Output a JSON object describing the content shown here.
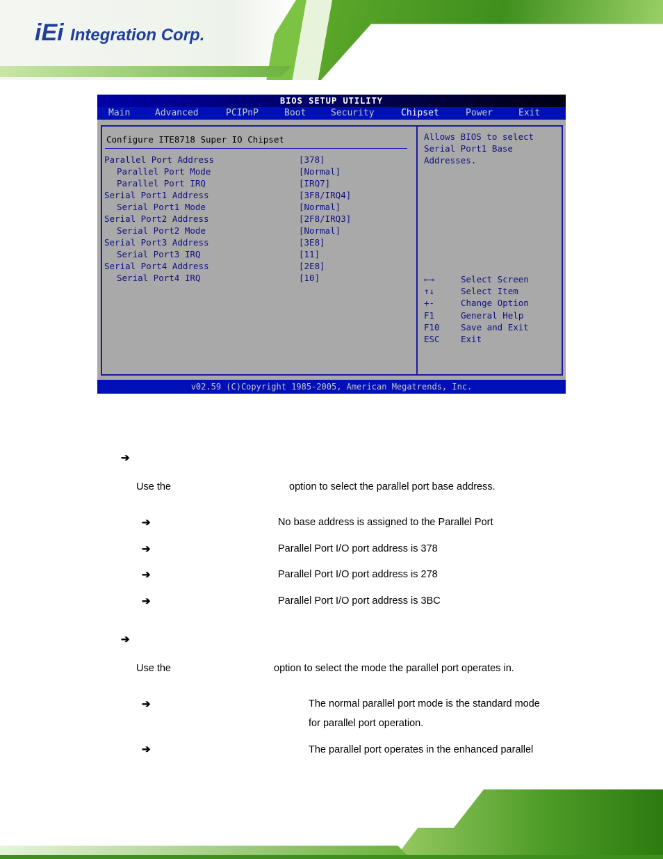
{
  "logo": {
    "text": "iEi",
    "sub": "Integration Corp."
  },
  "bios": {
    "title": "BIOS SETUP UTILITY",
    "menu": [
      "Main",
      "Advanced",
      "PCIPnP",
      "Boot",
      "Security",
      "Chipset",
      "Power",
      "Exit"
    ],
    "section_title": "Configure ITE8718 Super IO Chipset",
    "items": [
      {
        "label": "Parallel Port Address",
        "value": "[378]",
        "indent": false
      },
      {
        "label": "Parallel Port Mode",
        "value": "[Normal]",
        "indent": true
      },
      {
        "label": "Parallel Port IRQ",
        "value": "[IRQ7]",
        "indent": true
      },
      {
        "label": "Serial Port1 Address",
        "value": "[3F8/IRQ4]",
        "indent": false
      },
      {
        "label": "Serial Port1 Mode",
        "value": "[Normal]",
        "indent": true
      },
      {
        "label": "Serial Port2 Address",
        "value": "[2F8/IRQ3]",
        "indent": false
      },
      {
        "label": "Serial Port2 Mode",
        "value": "[Normal]",
        "indent": true
      },
      {
        "label": "Serial Port3 Address",
        "value": "[3E8]",
        "indent": false
      },
      {
        "label": "Serial Port3 IRQ",
        "value": "[11]",
        "indent": true
      },
      {
        "label": "Serial Port4 Address",
        "value": "[2E8]",
        "indent": false
      },
      {
        "label": "Serial Port4 IRQ",
        "value": "[10]",
        "indent": true
      }
    ],
    "help": [
      "Allows BIOS to select",
      "Serial Port1 Base",
      "Addresses."
    ],
    "keys": [
      {
        "key": "←→",
        "desc": "Select Screen"
      },
      {
        "key": "↑↓",
        "desc": "Select Item"
      },
      {
        "key": "+-",
        "desc": "Change Option"
      },
      {
        "key": "F1",
        "desc": "General Help"
      },
      {
        "key": "F10",
        "desc": "Save and Exit"
      },
      {
        "key": "ESC",
        "desc": "Exit"
      }
    ],
    "footer": "v02.59 (C)Copyright 1985-2005, American Megatrends, Inc."
  },
  "doc": {
    "arrow": "➔",
    "p1_pre": "Use the",
    "p1_post": "option to select the parallel port base address.",
    "opts1": [
      "No base address is assigned to the Parallel Port",
      "Parallel Port I/O port address is 378",
      "Parallel Port I/O port address is 278",
      "Parallel Port I/O port address is 3BC"
    ],
    "p2_pre": "Use the",
    "p2_post": "option to select the mode the parallel port operates in.",
    "opts2": [
      [
        "The normal parallel port mode is the standard mode",
        "for parallel port operation."
      ],
      [
        "The parallel port operates in the enhanced parallel"
      ]
    ]
  }
}
